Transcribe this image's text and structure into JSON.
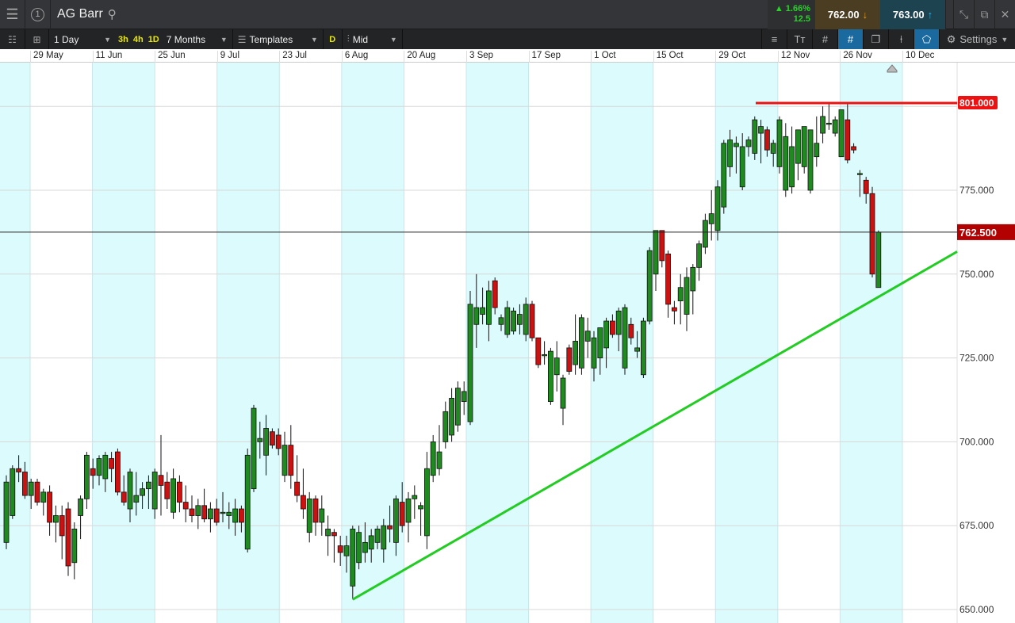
{
  "header": {
    "title": "AG Barr",
    "window_number": "1",
    "change_pct": "▲ 1.66%",
    "change_abs": "12.5",
    "sell_price": "762.00",
    "buy_price": "763.00"
  },
  "toolbar": {
    "interval": "1 Day",
    "quick": [
      "3h",
      "4h",
      "1D"
    ],
    "range": "7 Months",
    "templates": "Templates",
    "d_label": "D",
    "price_type": "Mid",
    "settings": "Settings"
  },
  "colors": {
    "up": "#1f8a1f",
    "down": "#cc1111",
    "band": "#dcfbfd",
    "trend": "#22cc22",
    "resistance": "#ee1111",
    "last": "#b30000"
  },
  "chart_data": {
    "type": "candlestick",
    "instrument": "AG Barr",
    "x_labels": [
      "29 May",
      "11 Jun",
      "25 Jun",
      "9 Jul",
      "23 Jul",
      "6 Aug",
      "20 Aug",
      "3 Sep",
      "17 Sep",
      "1 Oct",
      "15 Oct",
      "29 Oct",
      "12 Nov",
      "26 Nov",
      "10 Dec"
    ],
    "y_ticks": [
      "650.000",
      "675.000",
      "700.000",
      "725.000",
      "750.000",
      "775.000",
      "800.000"
    ],
    "y_tick_values": [
      650,
      675,
      700,
      725,
      750,
      775,
      800
    ],
    "ylim": [
      647,
      816
    ],
    "last_price": {
      "value": 762.5,
      "label": "762.500"
    },
    "resistance": {
      "value": 801,
      "label": "801.000"
    },
    "trendline": {
      "from": [
        56,
        653
      ],
      "to": [
        154,
        757
      ]
    },
    "ohlc": [
      [
        670,
        690,
        668,
        688
      ],
      [
        678,
        693,
        677,
        692
      ],
      [
        692,
        696,
        688,
        691
      ],
      [
        691,
        694,
        683,
        684
      ],
      [
        684,
        689,
        680,
        688
      ],
      [
        688,
        689,
        681,
        682
      ],
      [
        682,
        686,
        678,
        685
      ],
      [
        685,
        687,
        672,
        676
      ],
      [
        676,
        681,
        670,
        678
      ],
      [
        678,
        681,
        665,
        672
      ],
      [
        680,
        682,
        660,
        663
      ],
      [
        664,
        676,
        659,
        674
      ],
      [
        678,
        684,
        671,
        683
      ],
      [
        683,
        697,
        680,
        696
      ],
      [
        692,
        695,
        686,
        690
      ],
      [
        690,
        696,
        687,
        695
      ],
      [
        689,
        697,
        685,
        696
      ],
      [
        695,
        697,
        688,
        692
      ],
      [
        697,
        698,
        684,
        685
      ],
      [
        685,
        690,
        681,
        682
      ],
      [
        680,
        692,
        676,
        691
      ],
      [
        682,
        691,
        678,
        684
      ],
      [
        684,
        688,
        680,
        686
      ],
      [
        686,
        690,
        680,
        688
      ],
      [
        680,
        692,
        677,
        691
      ],
      [
        690,
        702,
        678,
        687
      ],
      [
        688,
        691,
        680,
        683
      ],
      [
        679,
        692,
        677,
        689
      ],
      [
        688,
        690,
        679,
        682
      ],
      [
        682,
        687,
        676,
        680
      ],
      [
        680,
        684,
        676,
        678
      ],
      [
        678,
        683,
        674,
        681
      ],
      [
        681,
        686,
        676,
        677
      ],
      [
        677,
        682,
        673,
        680
      ],
      [
        680,
        683,
        675,
        676
      ],
      [
        679,
        685,
        676,
        679
      ],
      [
        678,
        682,
        674,
        679
      ],
      [
        676,
        683,
        672,
        680
      ],
      [
        680,
        681,
        673,
        676
      ],
      [
        668,
        698,
        667,
        696
      ],
      [
        686,
        711,
        685,
        710
      ],
      [
        700,
        706,
        695,
        701
      ],
      [
        696,
        708,
        690,
        704
      ],
      [
        703,
        704,
        698,
        699
      ],
      [
        702,
        704,
        696,
        698
      ],
      [
        690,
        703,
        688,
        699
      ],
      [
        699,
        705,
        686,
        690
      ],
      [
        688,
        696,
        682,
        684
      ],
      [
        684,
        692,
        677,
        680
      ],
      [
        673,
        685,
        670,
        683
      ],
      [
        683,
        684,
        672,
        676
      ],
      [
        676,
        684,
        672,
        680
      ],
      [
        672,
        678,
        666,
        674
      ],
      [
        673,
        674,
        664,
        672
      ],
      [
        669,
        672,
        663,
        667
      ],
      [
        666,
        672,
        661,
        669
      ],
      [
        657,
        675,
        653,
        674
      ],
      [
        664,
        675,
        662,
        673
      ],
      [
        667,
        676,
        664,
        670
      ],
      [
        668,
        674,
        664,
        672
      ],
      [
        670,
        675,
        668,
        674
      ],
      [
        668,
        677,
        664,
        675
      ],
      [
        675,
        681,
        670,
        674
      ],
      [
        670,
        684,
        666,
        683
      ],
      [
        682,
        688,
        673,
        675
      ],
      [
        676,
        685,
        670,
        683
      ],
      [
        683,
        687,
        677,
        684
      ],
      [
        680,
        682,
        672,
        681
      ],
      [
        672,
        697,
        668,
        692
      ],
      [
        690,
        702,
        688,
        700
      ],
      [
        692,
        705,
        690,
        697
      ],
      [
        700,
        712,
        698,
        709
      ],
      [
        702,
        716,
        700,
        713
      ],
      [
        705,
        718,
        703,
        716
      ],
      [
        712,
        718,
        708,
        715
      ],
      [
        706,
        745,
        705,
        741
      ],
      [
        735,
        750,
        728,
        740
      ],
      [
        738,
        746,
        735,
        740
      ],
      [
        735,
        748,
        730,
        745
      ],
      [
        748,
        749,
        738,
        740
      ],
      [
        735,
        738,
        733,
        737
      ],
      [
        732,
        742,
        731,
        740
      ],
      [
        733,
        740,
        732,
        739
      ],
      [
        735,
        741,
        732,
        738
      ],
      [
        732,
        743,
        730,
        741
      ],
      [
        741,
        742,
        730,
        731
      ],
      [
        731,
        731,
        722,
        723
      ],
      [
        726,
        730,
        723,
        726
      ],
      [
        712,
        728,
        711,
        727
      ],
      [
        720,
        730,
        715,
        725
      ],
      [
        710,
        720,
        705,
        719
      ],
      [
        728,
        729,
        720,
        721
      ],
      [
        723,
        738,
        720,
        730
      ],
      [
        722,
        738,
        720,
        737
      ],
      [
        730,
        737,
        725,
        733
      ],
      [
        722,
        733,
        718,
        731
      ],
      [
        725,
        734,
        720,
        734
      ],
      [
        728,
        737,
        722,
        736
      ],
      [
        736,
        738,
        731,
        732
      ],
      [
        732,
        740,
        727,
        739
      ],
      [
        722,
        741,
        720,
        740
      ],
      [
        735,
        737,
        729,
        731
      ],
      [
        727,
        733,
        725,
        728
      ],
      [
        720,
        737,
        719,
        736
      ],
      [
        736,
        758,
        735,
        757
      ],
      [
        750,
        763,
        745,
        763
      ],
      [
        763,
        763,
        752,
        754
      ],
      [
        756,
        757,
        737,
        741
      ],
      [
        740,
        742,
        735,
        739
      ],
      [
        742,
        750,
        735,
        746
      ],
      [
        738,
        752,
        733,
        749
      ],
      [
        745,
        753,
        738,
        752
      ],
      [
        752,
        760,
        748,
        759
      ],
      [
        758,
        768,
        756,
        766
      ],
      [
        765,
        775,
        760,
        768
      ],
      [
        763,
        778,
        760,
        776
      ],
      [
        770,
        790,
        768,
        789
      ],
      [
        782,
        793,
        779,
        790
      ],
      [
        788,
        791,
        780,
        789
      ],
      [
        776,
        792,
        775,
        788
      ],
      [
        788,
        791,
        785,
        790
      ],
      [
        786,
        797,
        784,
        796
      ],
      [
        792,
        796,
        783,
        794
      ],
      [
        793,
        794,
        785,
        787
      ],
      [
        786,
        790,
        782,
        789
      ],
      [
        782,
        797,
        780,
        796
      ],
      [
        775,
        795,
        773,
        791
      ],
      [
        776,
        794,
        774,
        788
      ],
      [
        783,
        793,
        778,
        793
      ],
      [
        782,
        794,
        780,
        794
      ],
      [
        775,
        793,
        774,
        793
      ],
      [
        785,
        797,
        782,
        789
      ],
      [
        792,
        800,
        789,
        797
      ],
      [
        795,
        801,
        793,
        795
      ],
      [
        792,
        797,
        791,
        796
      ],
      [
        785,
        799,
        785,
        799
      ],
      [
        796,
        801,
        783,
        784
      ],
      [
        788,
        789,
        786,
        787
      ],
      [
        780,
        781,
        773,
        780
      ],
      [
        778,
        779,
        771,
        774
      ],
      [
        774,
        776,
        749,
        750
      ],
      [
        746,
        763,
        746,
        762.5
      ]
    ]
  }
}
